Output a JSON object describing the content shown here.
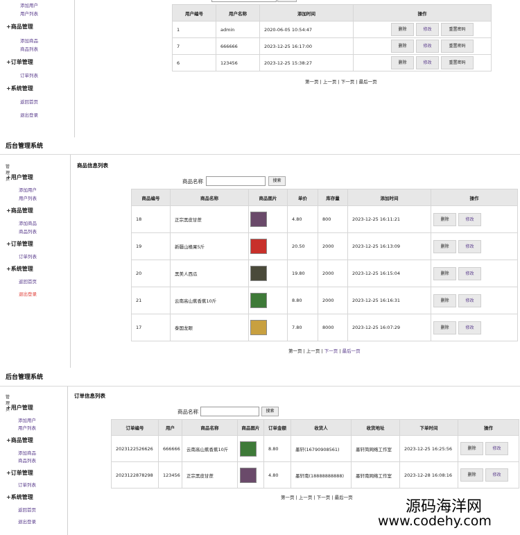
{
  "app_title": "后台管理系统",
  "sidebar": {
    "role": "管理员",
    "groups": [
      {
        "label": "+用户管理",
        "items": [
          "添加用户",
          "用户列表"
        ]
      },
      {
        "label": "+商品管理",
        "items": [
          "添加商品",
          "商品列表"
        ]
      },
      {
        "label": "+订单管理",
        "items": [
          "订单列表"
        ]
      },
      {
        "label": "+系统管理",
        "items": [
          "返回首页",
          "退出登录"
        ]
      }
    ]
  },
  "user_panel": {
    "headers": [
      "用户编号",
      "用户名称",
      "添加时间",
      "操作"
    ],
    "rows": [
      {
        "id": "1",
        "name": "admin",
        "time": "2020-06-05 10:54:47"
      },
      {
        "id": "7",
        "name": "666666",
        "time": "2023-12-25 16:17:00"
      },
      {
        "id": "6",
        "name": "123456",
        "time": "2023-12-25 15:38:27"
      }
    ],
    "actions": {
      "delete": "删除",
      "edit": "修改",
      "reset": "重置密码"
    }
  },
  "pager": {
    "first": "第一页",
    "prev": "上一页",
    "next": "下一页",
    "last": "最后一页",
    "sep": "|"
  },
  "product_panel": {
    "title": "商品信息列表",
    "search_label": "商品名称",
    "search_button": "搜索",
    "headers": [
      "商品编号",
      "商品名称",
      "商品图片",
      "单价",
      "库存量",
      "添加时间",
      "操作"
    ],
    "rows": [
      {
        "id": "18",
        "name": "正宗黑皮甘蔗",
        "price": "4.80",
        "stock": "800",
        "time": "2023-12-25 16:11:21",
        "img": "#6a4a6a"
      },
      {
        "id": "19",
        "name": "新疆山楂果5斤",
        "price": "20.50",
        "stock": "2000",
        "time": "2023-12-25 16:13:09",
        "img": "#c8302a"
      },
      {
        "id": "20",
        "name": "黑美人西瓜",
        "price": "19.80",
        "stock": "2000",
        "time": "2023-12-25 16:15:04",
        "img": "#4a4a3a"
      },
      {
        "id": "21",
        "name": "云南高山蕉香蕉10斤",
        "price": "8.80",
        "stock": "2000",
        "time": "2023-12-25 16:16:31",
        "img": "#3e7a38"
      },
      {
        "id": "17",
        "name": "泰国龙眼",
        "price": "7.80",
        "stock": "8000",
        "time": "2023-12-25 16:07:29",
        "img": "#c8a040"
      }
    ],
    "actions": {
      "delete": "删除",
      "edit": "修改"
    }
  },
  "order_panel": {
    "title": "订单信息列表",
    "search_label": "商品名称",
    "search_button": "搜索",
    "headers": [
      "订单编号",
      "用户",
      "商品名称",
      "商品图片",
      "订单金额",
      "收货人",
      "收货地址",
      "下单时间",
      "操作"
    ],
    "rows": [
      {
        "id": "2023122526626",
        "user": "666666",
        "name": "云南高山蕉香蕉10斤",
        "amount": "8.80",
        "receiver": "墨轩(16790908561)",
        "address": "墨轩简网络工作室",
        "time": "2023-12-25 16:25:56",
        "img": "#3e7a38"
      },
      {
        "id": "2023122878298",
        "user": "123456",
        "name": "正宗黑皮甘蔗",
        "amount": "4.80",
        "receiver": "墨轩南(18888888888)",
        "address": "墨轩南网络工作室",
        "time": "2023-12-28 16:08:16",
        "img": "#6a4a6a"
      }
    ],
    "actions": {
      "delete": "删除",
      "edit": "修改"
    }
  },
  "watermark": {
    "line1": "源码海洋网",
    "line2": "www.codehy.com"
  }
}
